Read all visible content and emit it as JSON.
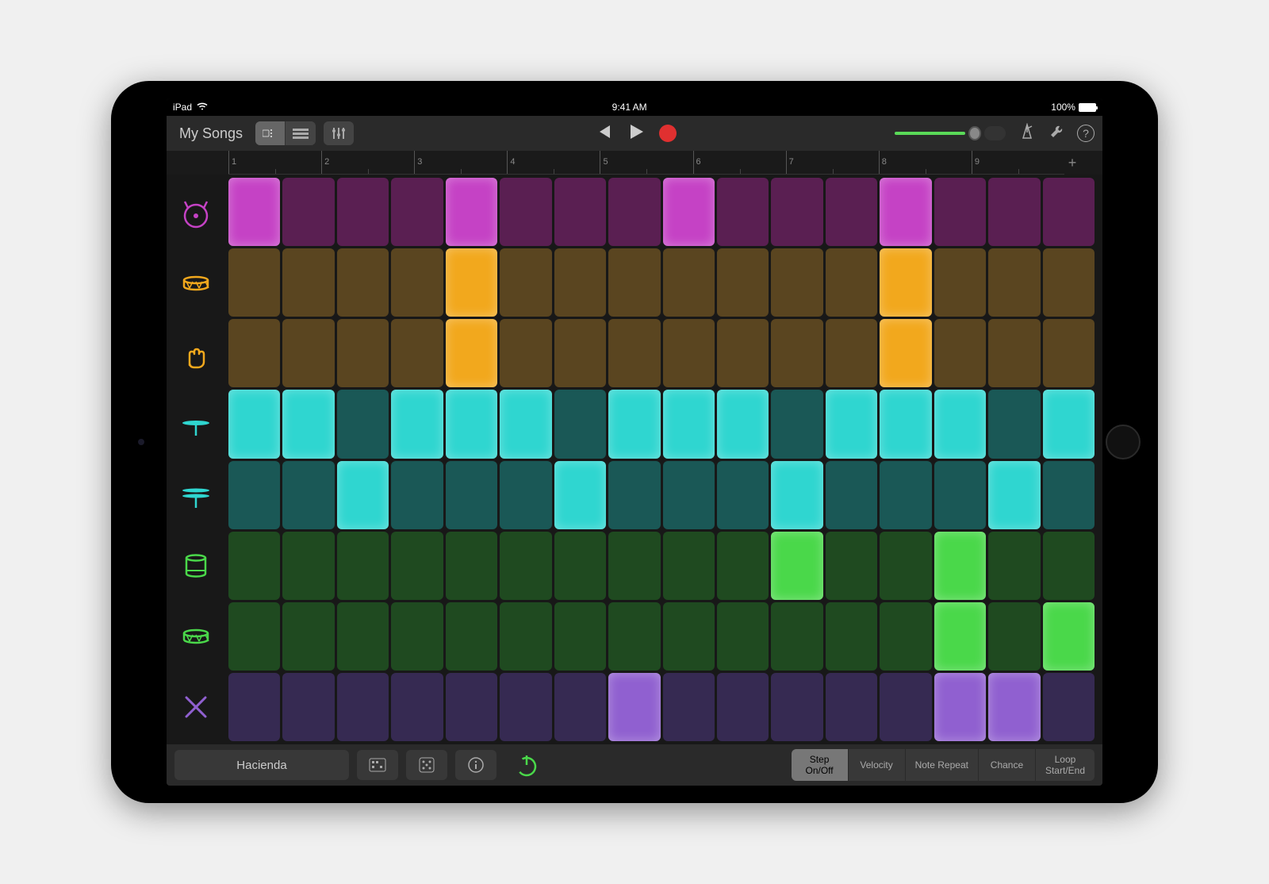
{
  "status": {
    "device": "iPad",
    "time": "9:41 AM",
    "battery": "100%"
  },
  "toolbar": {
    "back_label": "My Songs"
  },
  "ruler": {
    "bars": [
      "1",
      "2",
      "3",
      "4",
      "5",
      "6",
      "7",
      "8",
      "9"
    ],
    "add": "+"
  },
  "rows": [
    {
      "icon": "kick",
      "color": "#c542c5",
      "dim": "#5a1f52",
      "active": [
        0,
        4,
        8,
        12
      ]
    },
    {
      "icon": "snare",
      "color": "#f2a81d",
      "dim": "#5a4520",
      "active": [
        4,
        12
      ]
    },
    {
      "icon": "clap",
      "color": "#f2a81d",
      "dim": "#5a4520",
      "active": [
        4,
        12
      ]
    },
    {
      "icon": "hihat-closed",
      "color": "#2fd6d0",
      "dim": "#1a5856",
      "active": [
        0,
        1,
        3,
        4,
        5,
        7,
        8,
        9,
        11,
        12,
        13,
        15
      ]
    },
    {
      "icon": "hihat-open",
      "color": "#2fd6d0",
      "dim": "#1a5856",
      "active": [
        2,
        6,
        10,
        14
      ]
    },
    {
      "icon": "tom",
      "color": "#4ad84a",
      "dim": "#1f4a20",
      "active": [
        10,
        13
      ]
    },
    {
      "icon": "snare-alt",
      "color": "#4ad84a",
      "dim": "#1f4a20",
      "active": [
        13,
        15
      ]
    },
    {
      "icon": "sticks",
      "color": "#9060d0",
      "dim": "#362a52",
      "active": [
        7,
        13,
        14
      ]
    }
  ],
  "footer": {
    "preset": "Hacienda",
    "modes": [
      "Step\nOn/Off",
      "Velocity",
      "Note Repeat",
      "Chance",
      "Loop\nStart/End"
    ],
    "active_mode": 0
  }
}
